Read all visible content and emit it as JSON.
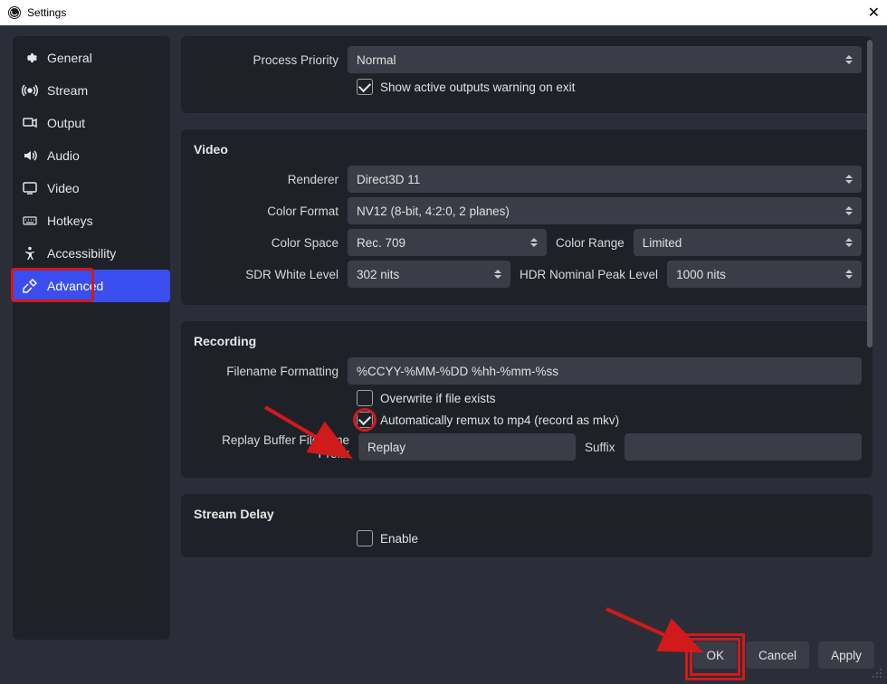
{
  "window": {
    "title": "Settings"
  },
  "sidebar": {
    "items": [
      {
        "label": "General"
      },
      {
        "label": "Stream"
      },
      {
        "label": "Output"
      },
      {
        "label": "Audio"
      },
      {
        "label": "Video"
      },
      {
        "label": "Hotkeys"
      },
      {
        "label": "Accessibility"
      },
      {
        "label": "Advanced"
      }
    ]
  },
  "general": {
    "process_priority_label": "Process Priority",
    "process_priority_value": "Normal",
    "show_active_outputs_label": "Show active outputs warning on exit",
    "show_active_outputs_checked": true
  },
  "video": {
    "title": "Video",
    "renderer_label": "Renderer",
    "renderer_value": "Direct3D 11",
    "color_format_label": "Color Format",
    "color_format_value": "NV12 (8-bit, 4:2:0, 2 planes)",
    "color_space_label": "Color Space",
    "color_space_value": "Rec. 709",
    "color_range_label": "Color Range",
    "color_range_value": "Limited",
    "sdr_white_label": "SDR White Level",
    "sdr_white_value": "302 nits",
    "hdr_peak_label": "HDR Nominal Peak Level",
    "hdr_peak_value": "1000 nits"
  },
  "recording": {
    "title": "Recording",
    "filename_formatting_label": "Filename Formatting",
    "filename_formatting_value": "%CCYY-%MM-%DD %hh-%mm-%ss",
    "overwrite_label": "Overwrite if file exists",
    "overwrite_checked": false,
    "auto_remux_label": "Automatically remux to mp4 (record as mkv)",
    "auto_remux_checked": true,
    "replay_prefix_label": "Replay Buffer Filename Prefix",
    "replay_prefix_value": "Replay",
    "suffix_label": "Suffix",
    "suffix_value": ""
  },
  "stream_delay": {
    "title": "Stream Delay",
    "enable_label": "Enable",
    "enable_checked": false
  },
  "footer": {
    "ok": "OK",
    "cancel": "Cancel",
    "apply": "Apply"
  }
}
